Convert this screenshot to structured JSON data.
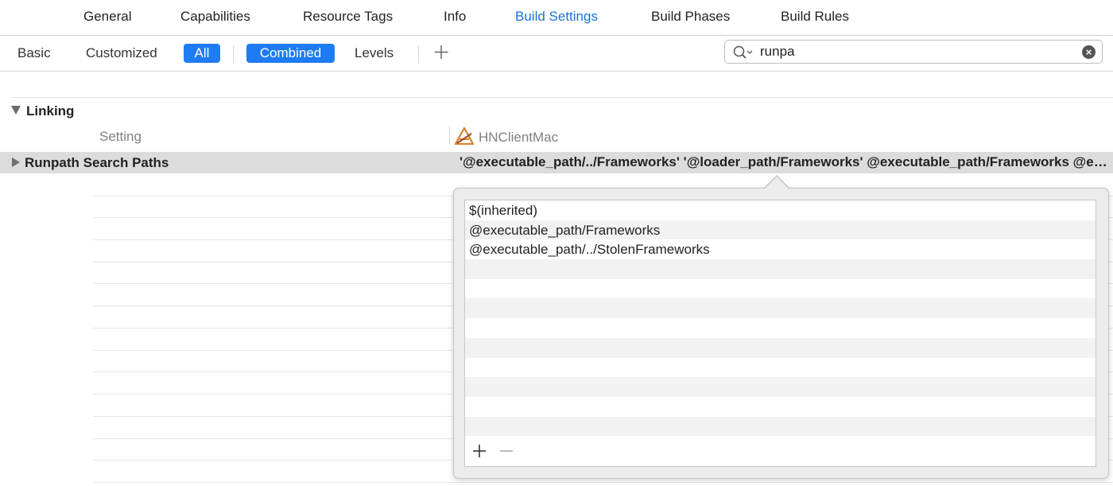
{
  "tabs": [
    {
      "label": "General",
      "active": false
    },
    {
      "label": "Capabilities",
      "active": false
    },
    {
      "label": "Resource Tags",
      "active": false
    },
    {
      "label": "Info",
      "active": false
    },
    {
      "label": "Build Settings",
      "active": true
    },
    {
      "label": "Build Phases",
      "active": false
    },
    {
      "label": "Build Rules",
      "active": false
    }
  ],
  "filters": {
    "basic": "Basic",
    "customized": "Customized",
    "all": "All",
    "combined": "Combined",
    "levels": "Levels",
    "add": "+"
  },
  "search": {
    "value": "runpa"
  },
  "section": {
    "title": "Linking"
  },
  "columns": {
    "setting": "Setting",
    "target": "HNClientMac"
  },
  "setting_row": {
    "name": "Runpath Search Paths",
    "value": "'@executable_path/../Frameworks' '@loader_path/Frameworks' @executable_path/Frameworks @executable_path/../StolenFrameworks"
  },
  "popover": {
    "items": [
      "$(inherited)",
      "@executable_path/Frameworks",
      "@executable_path/../StolenFrameworks"
    ]
  },
  "colors": {
    "accent": "#1e7cf2",
    "active_tab": "#1a73d9",
    "row_highlight": "#dcdcdc"
  }
}
